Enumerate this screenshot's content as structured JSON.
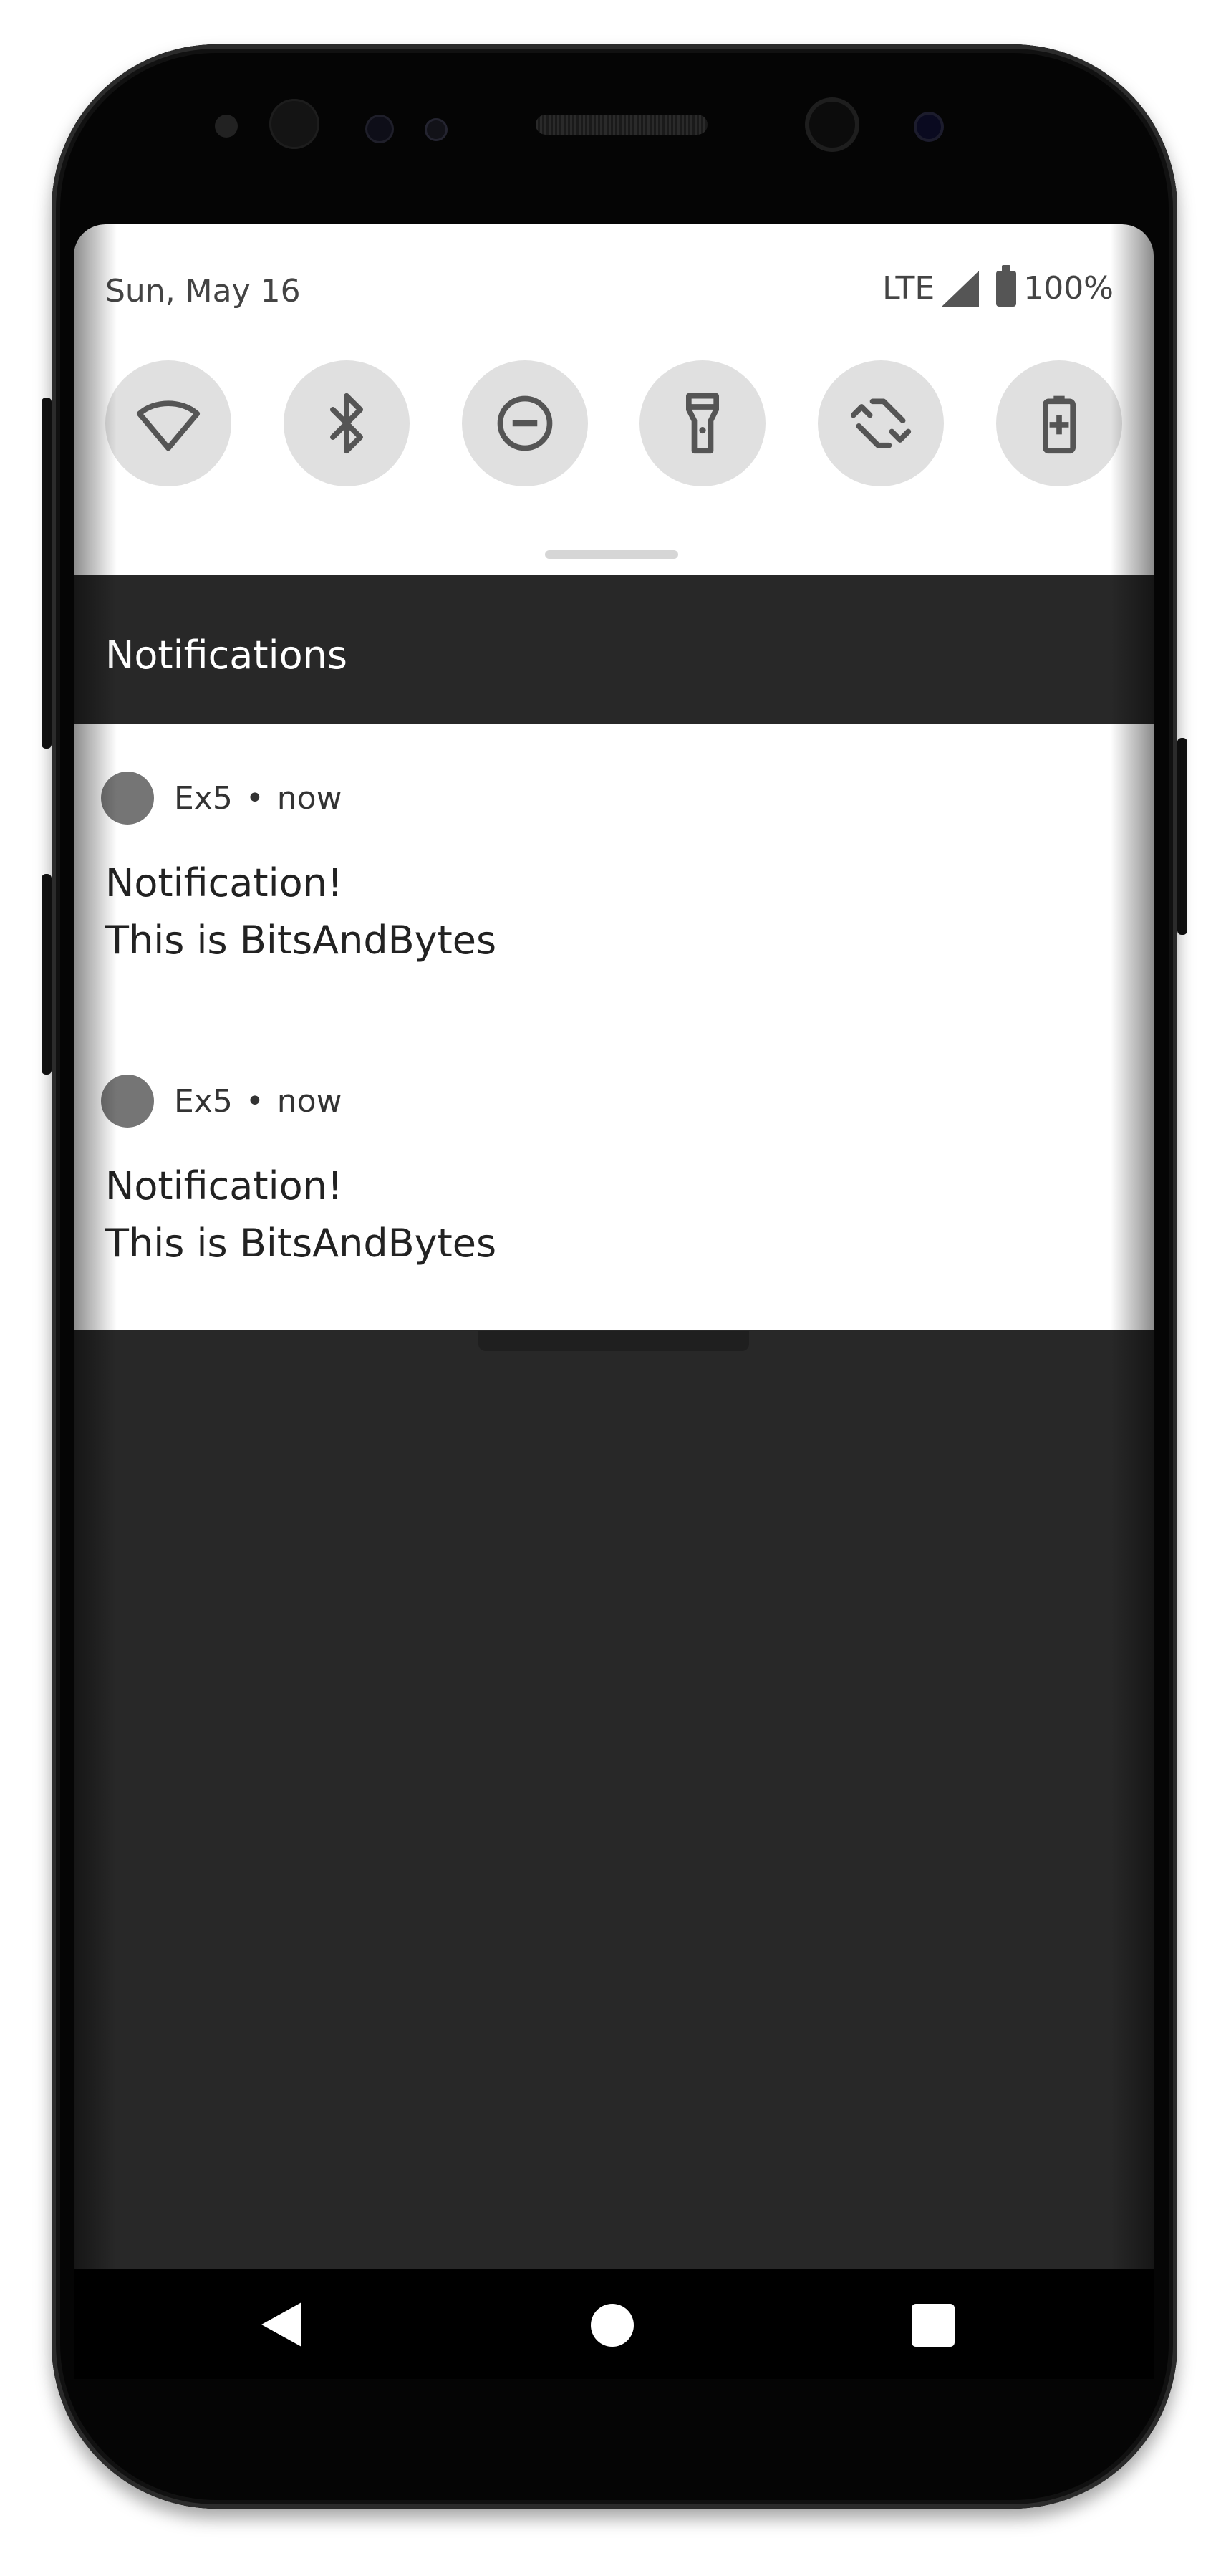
{
  "status_bar": {
    "date": "Sun, May 16",
    "network": "LTE",
    "battery_percent": "100%"
  },
  "quick_settings": {
    "tiles": [
      {
        "icon": "wifi-icon"
      },
      {
        "icon": "bluetooth-icon"
      },
      {
        "icon": "do-not-disturb-icon"
      },
      {
        "icon": "flashlight-icon"
      },
      {
        "icon": "auto-rotate-icon"
      },
      {
        "icon": "battery-saver-icon"
      }
    ]
  },
  "notifications": {
    "header": "Notifications",
    "items": [
      {
        "app": "Ex5",
        "separator": "•",
        "time": "now",
        "title": "Notification!",
        "body": "This is BitsAndBytes"
      },
      {
        "app": "Ex5",
        "separator": "•",
        "time": "now",
        "title": "Notification!",
        "body": "This is BitsAndBytes"
      }
    ]
  },
  "nav_bar": {
    "buttons": [
      "back-icon",
      "home-icon",
      "recents-icon"
    ]
  },
  "colors": {
    "panel": "#ffffff",
    "shade_background": "#282828",
    "tile_background": "#e0e0e0",
    "icon": "#555555",
    "app_icon": "#757575"
  }
}
